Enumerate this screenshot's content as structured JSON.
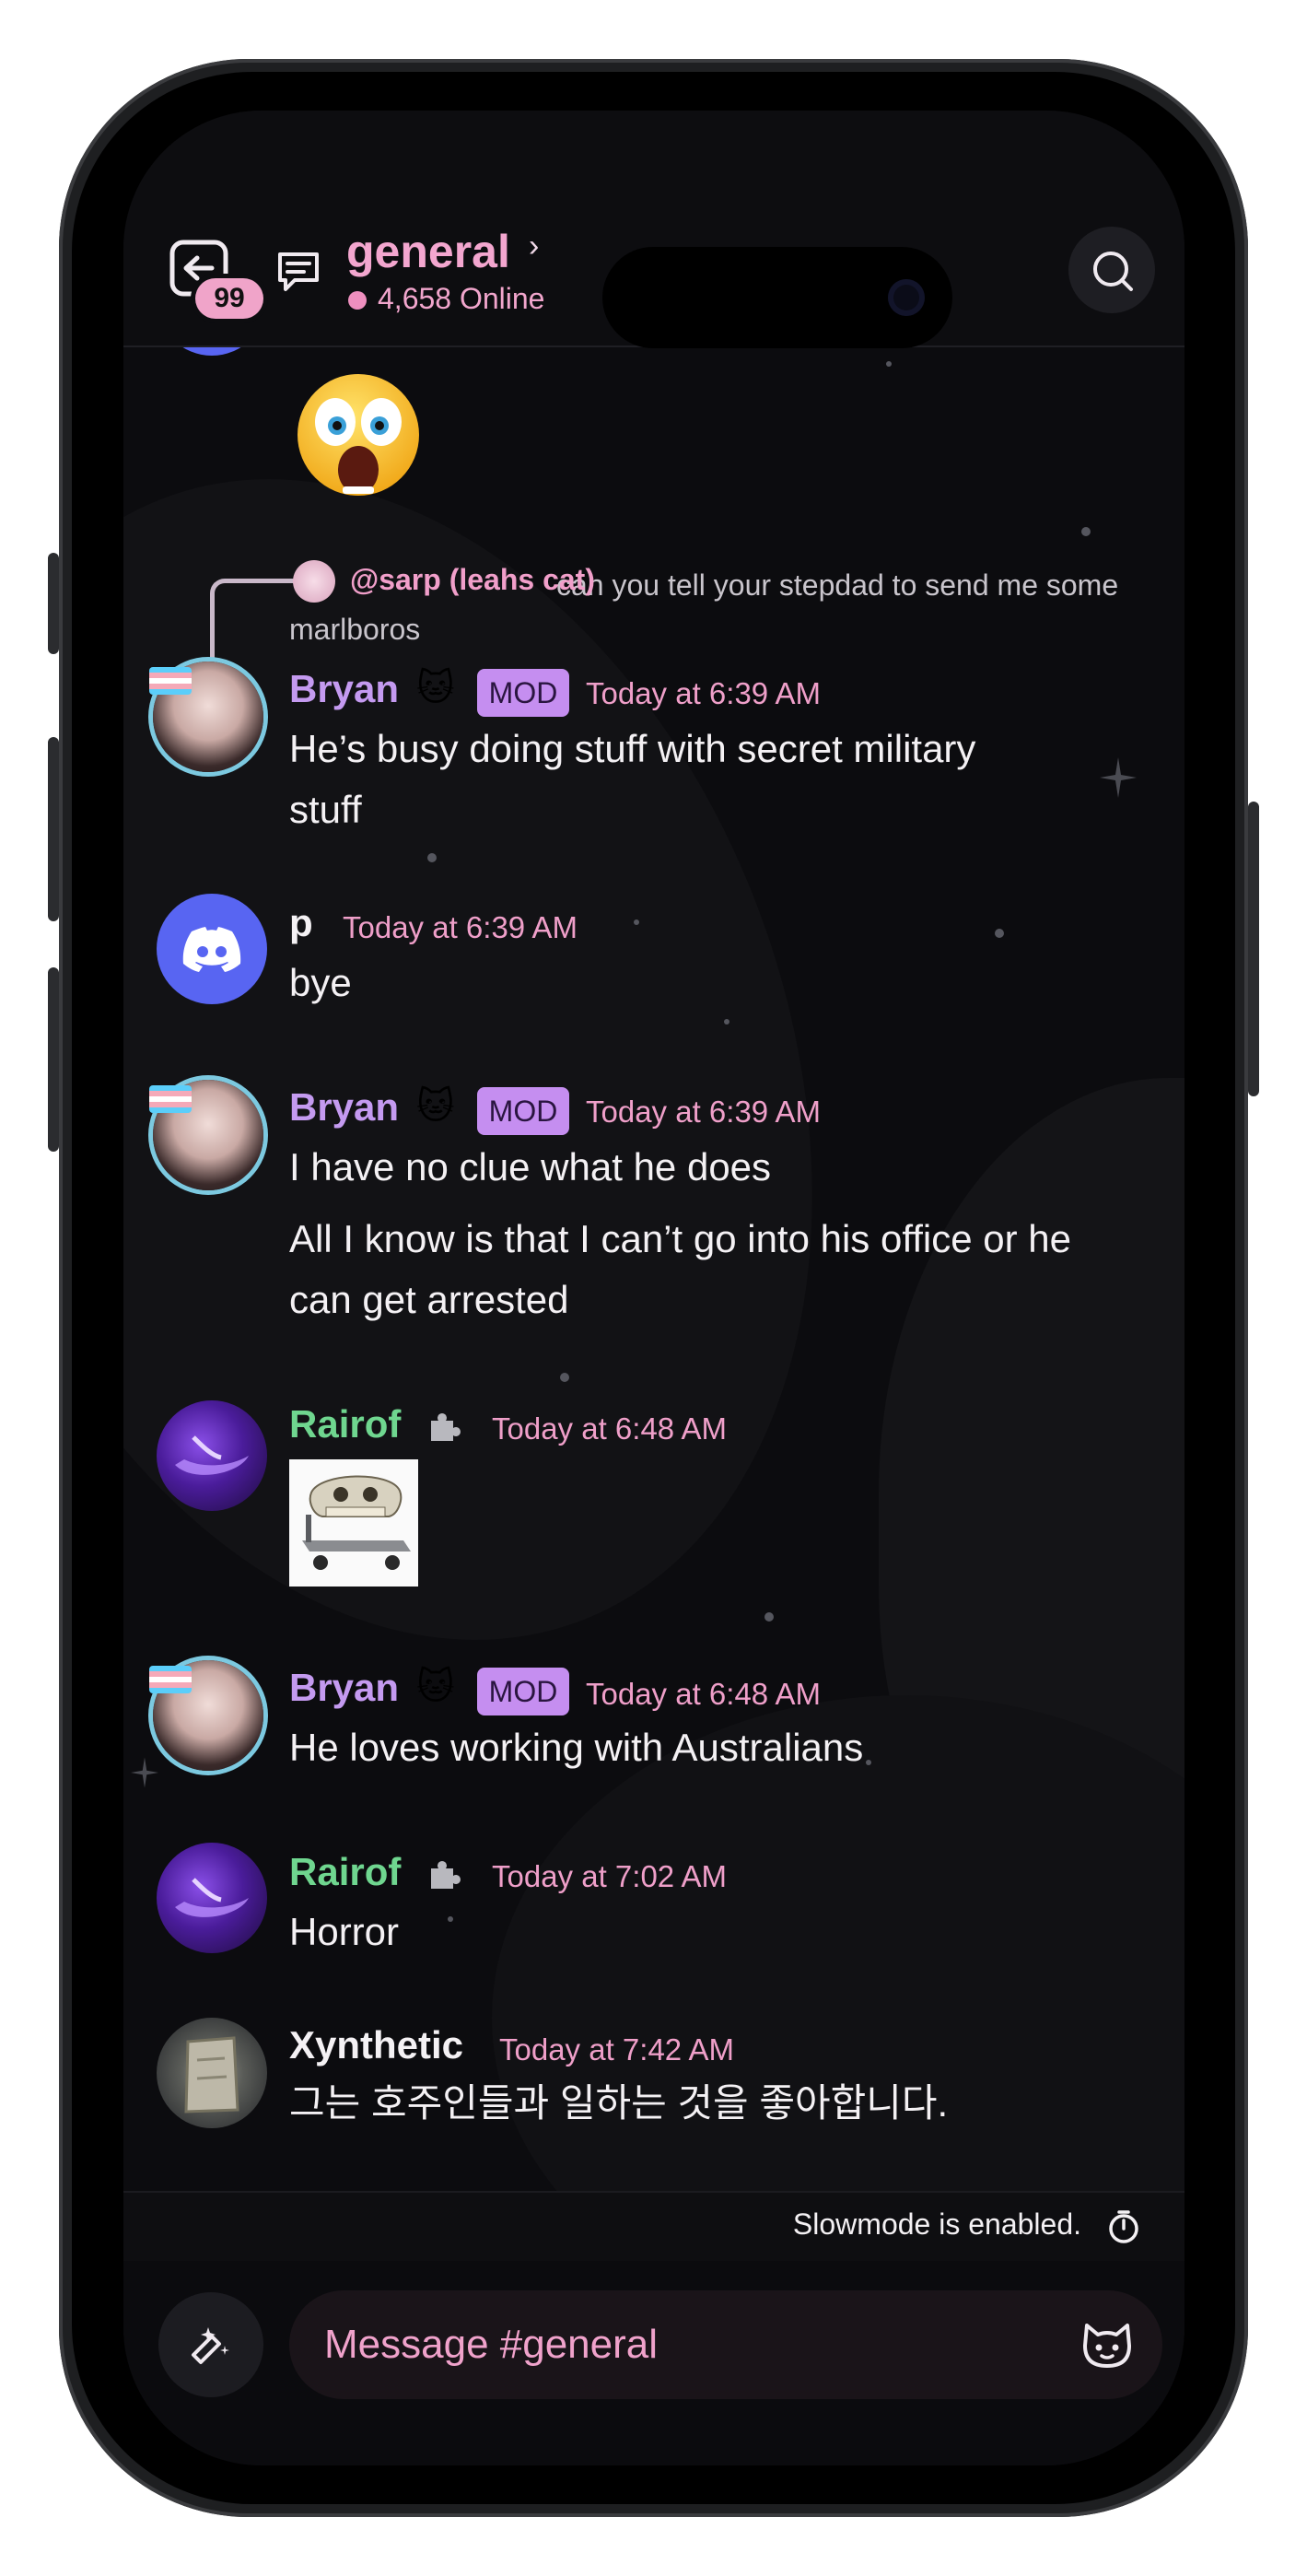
{
  "header": {
    "back_badge": "99",
    "channel_name": "general",
    "chevron": "›",
    "online_count": "4,658 Online"
  },
  "reply": {
    "name": "@sarp (leahs cat)",
    "text": "can you tell your stepdad to send me some marlboros"
  },
  "messages": [
    {
      "author": "Bryan",
      "emoji": "🐱",
      "badge": "MOD",
      "time": "Today at 6:39 AM",
      "lines": [
        "He’s busy doing stuff with secret military",
        "stuff"
      ]
    },
    {
      "author": "p",
      "time": "Today at 6:39 AM",
      "lines": [
        "bye"
      ]
    },
    {
      "author": "Bryan",
      "emoji": "🐱",
      "badge": "MOD",
      "time": "Today at 6:39 AM",
      "lines": [
        "I have no clue what he does",
        "All I know is that I can’t go into his office or he",
        "can get arrested"
      ]
    },
    {
      "author": "Rairof",
      "time": "Today at 6:48 AM"
    },
    {
      "author": "Bryan",
      "emoji": "🐱",
      "badge": "MOD",
      "time": "Today at 6:48 AM",
      "lines": [
        "He loves working with Australians"
      ]
    },
    {
      "author": "Rairof",
      "time": "Today at 7:02 AM",
      "lines": [
        "Horror"
      ]
    },
    {
      "author": "Xynthetic",
      "time": "Today at 7:42 AM",
      "lines": [
        "그는 호주인들과 일하는 것을 좋아합니다."
      ]
    }
  ],
  "slowmode_text": "Slowmode is enabled.",
  "composer": {
    "placeholder": "Message #general"
  },
  "colors": {
    "accent_pink": "#f3a6cf",
    "mod_purple": "#c58ef0",
    "bryan_name": "#c49af0",
    "rairof_name": "#6fd68f",
    "discord_blue": "#5865f2"
  },
  "icons": [
    "back-arrow-icon",
    "threads-icon",
    "search-icon",
    "discord-icon",
    "puzzle-icon",
    "apps-icon",
    "emoji-cat-icon",
    "timer-icon",
    "shocked-emoji-icon"
  ]
}
